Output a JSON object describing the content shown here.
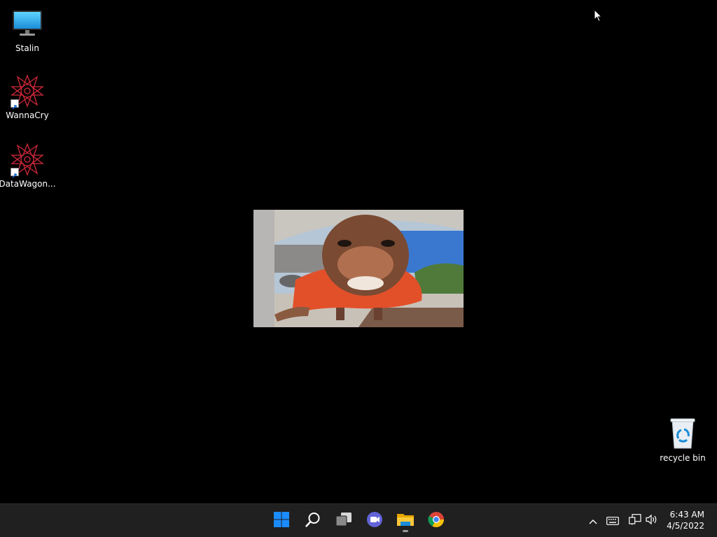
{
  "desktop": {
    "icons": [
      {
        "label": "Stalin",
        "icon": "computer-monitor-icon"
      },
      {
        "label": "WannaCry",
        "icon": "red-star-pattern-icon"
      },
      {
        "label": "DataWagon...",
        "icon": "red-star-pattern-icon"
      }
    ],
    "recycle_bin": {
      "label": "recycle bin",
      "icon": "recycle-bin-icon"
    },
    "video": {
      "description_icon": "video-frame-image"
    }
  },
  "taskbar": {
    "apps": [
      {
        "name": "start",
        "icon": "windows-logo-icon"
      },
      {
        "name": "search",
        "icon": "search-icon"
      },
      {
        "name": "task-view",
        "icon": "task-view-icon"
      },
      {
        "name": "chat",
        "icon": "teams-chat-icon"
      },
      {
        "name": "file-explorer",
        "icon": "folder-icon",
        "running": true
      },
      {
        "name": "chrome",
        "icon": "chrome-icon"
      }
    ],
    "tray": {
      "icons": [
        "chevron-up-icon",
        "keyboard-icon",
        "network-icon",
        "speaker-icon"
      ]
    },
    "clock": {
      "time": "6:43 AM",
      "date": "4/5/2022"
    }
  },
  "colors": {
    "desktop_bg": "#000000",
    "taskbar_bg": "#202020",
    "accent_blue": "#1a8cff",
    "wanna_red": "#d0283a"
  }
}
